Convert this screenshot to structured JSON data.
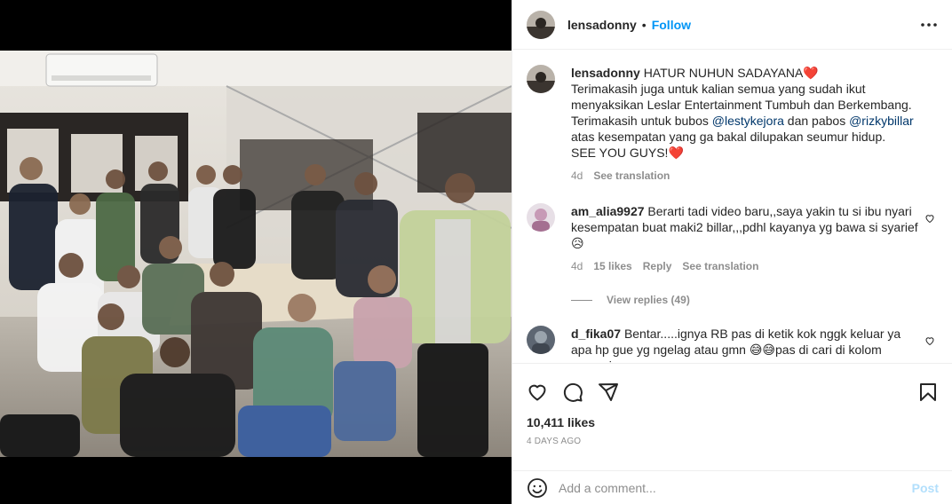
{
  "post": {
    "username": "lensadonny",
    "separator": "•",
    "follow_label": "Follow"
  },
  "caption": {
    "username": "lensadonny",
    "line1": "HATUR NUHUN SADAYANA",
    "line2": "Terimakasih juga untuk kalian semua yang sudah ikut menyaksikan Leslar Entertainment Tumbuh dan Berkembang.",
    "line3_pre": "Terimakasih untuk bubos",
    "mention1": "@lestykejora",
    "line3_mid": "dan pabos",
    "mention2": "@rizkybillar",
    "line4": "atas kesempatan yang ga bakal dilupakan seumur hidup.",
    "line5": "SEE YOU GUYS!",
    "age": "4d",
    "see_translation": "See translation"
  },
  "comments": [
    {
      "username": "am_alia9927",
      "text": "Berarti tadi video baru,,saya yakin tu si ibu nyari kesempatan buat maki2 billar,,,pdhl kayanya yg bawa si syarief",
      "emoji": "😥",
      "age": "4d",
      "likes": "15 likes",
      "reply": "Reply",
      "see_translation": "See translation",
      "view_replies": "View replies (49)"
    },
    {
      "username": "d_fika07",
      "text": "Bentar.....ignya RB pas di ketik kok nggk keluar ya apa hp gue yg ngelag atau gmn 😅😅pas di cari di kolom pencarian"
    }
  ],
  "stats": {
    "likes": "10,411 likes",
    "date": "4 DAYS AGO"
  },
  "composer": {
    "placeholder": "Add a comment...",
    "post_label": "Post"
  },
  "colors": {
    "link_blue": "#0095f6",
    "muted": "#8e8e8e",
    "mention": "#00376b",
    "heart_red": "#ed4956",
    "post_disabled": "#b2dffc"
  }
}
